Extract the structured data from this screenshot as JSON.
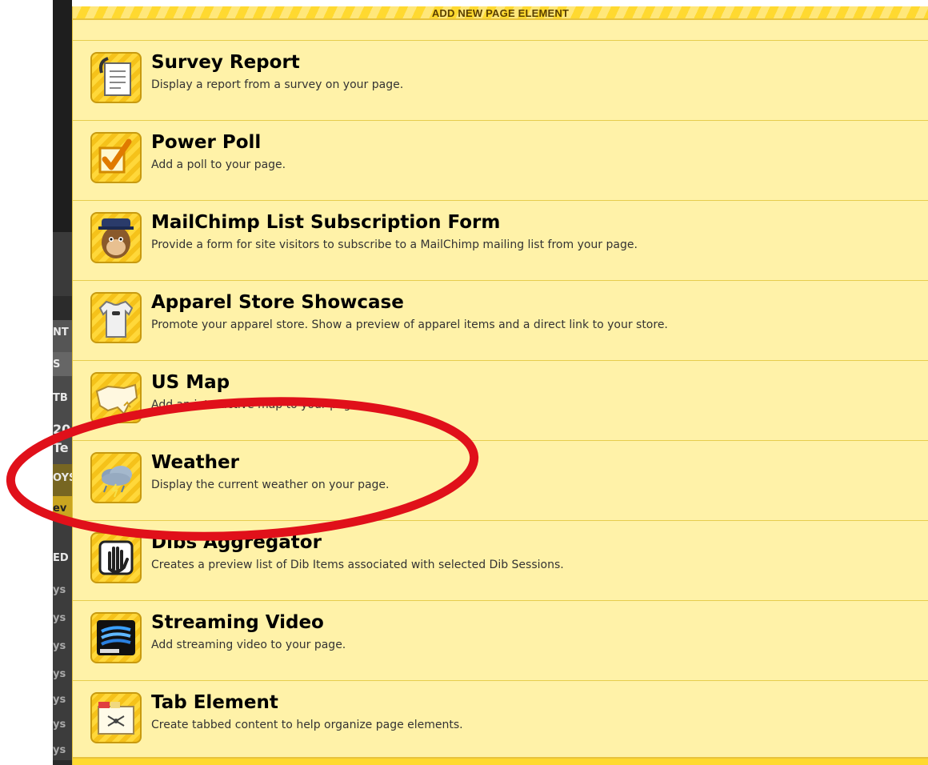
{
  "panel": {
    "title": "ADD NEW PAGE ELEMENT"
  },
  "background_fragments": [
    "NT",
    "S",
    "TB",
    "20",
    "Te",
    "OYS",
    "ev",
    "ED",
    "ys",
    "ys",
    "ys",
    "ys",
    "ys",
    "ys",
    "ys"
  ],
  "items": [
    {
      "title": "Survey Report",
      "description": "Display a report from a survey on your page.",
      "icon": "survey-report-icon"
    },
    {
      "title": "Power Poll",
      "description": "Add a poll to your page.",
      "icon": "power-poll-icon"
    },
    {
      "title": "MailChimp List Subscription Form",
      "description": "Provide a form for site visitors to subscribe to a MailChimp mailing list from your page.",
      "icon": "mailchimp-icon"
    },
    {
      "title": "Apparel Store Showcase",
      "description": "Promote your apparel store. Show a preview of apparel items and a direct link to your store.",
      "icon": "tshirt-icon"
    },
    {
      "title": "US Map",
      "description": "Add an interactive map to your page.",
      "icon": "us-map-icon"
    },
    {
      "title": "Weather",
      "description": "Display the current weather on your page.",
      "icon": "weather-icon"
    },
    {
      "title": "Dibs Aggregator",
      "description": "Creates a preview list of Dib Items associated with selected Dib Sessions.",
      "icon": "dibs-hand-icon"
    },
    {
      "title": "Streaming Video",
      "description": "Add streaming video to your page.",
      "icon": "streaming-video-icon"
    },
    {
      "title": "Tab Element",
      "description": "Create tabbed content to help organize page elements.",
      "icon": "tab-element-icon"
    }
  ],
  "annotation": {
    "shape": "ellipse",
    "color": "#e0101a",
    "target": "Weather"
  }
}
